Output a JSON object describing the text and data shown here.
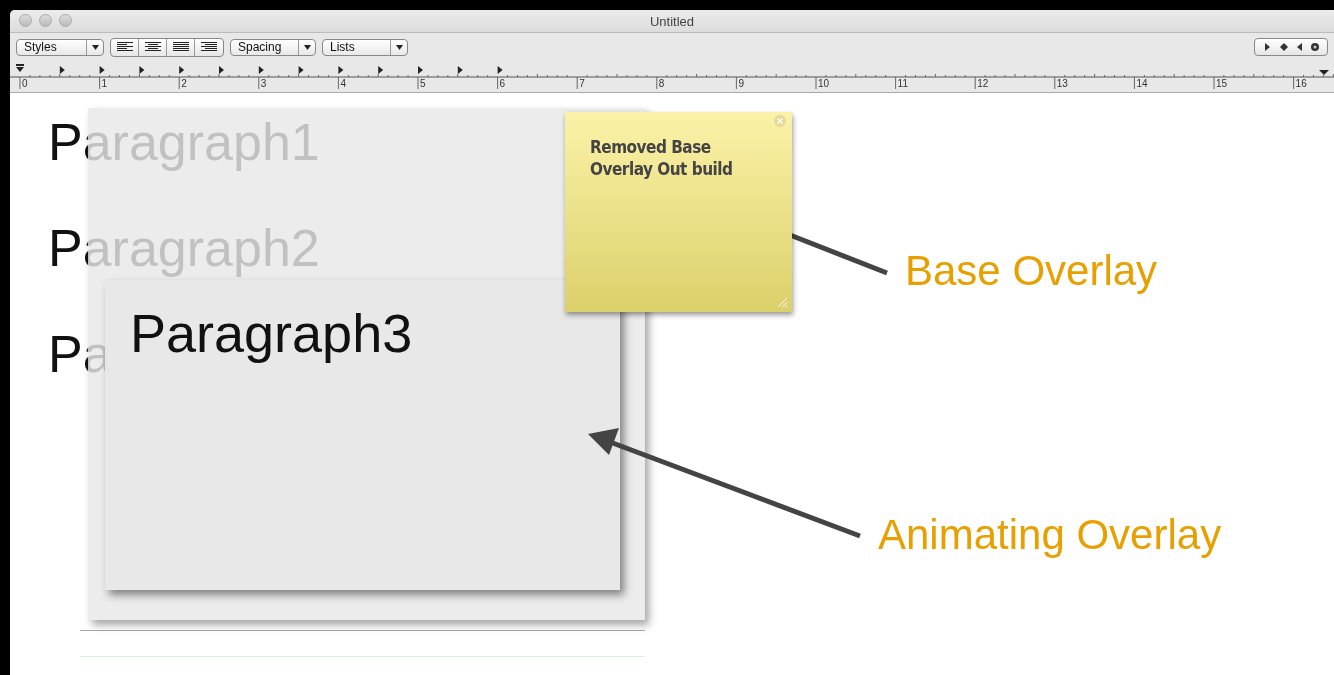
{
  "window": {
    "title": "Untitled"
  },
  "toolbar": {
    "styles_menu": {
      "label": "Styles"
    },
    "spacing_menu": {
      "label": "Spacing"
    },
    "lists_menu": {
      "label": "Lists"
    }
  },
  "ruler": {
    "labels": [
      "0",
      "1",
      "2",
      "3",
      "4",
      "5",
      "6",
      "7",
      "8",
      "9",
      "10",
      "11",
      "12",
      "13",
      "14",
      "15",
      "16"
    ]
  },
  "document": {
    "paragraphs": [
      "Paragraph1",
      "Paragraph2",
      "Pa"
    ]
  },
  "animating_overlay": {
    "text": "Paragraph3"
  },
  "sticky_note": {
    "text": "Removed Base Overlay Out build"
  },
  "callouts": [
    {
      "label": "Base Overlay"
    },
    {
      "label": "Animating Overlay"
    }
  ]
}
